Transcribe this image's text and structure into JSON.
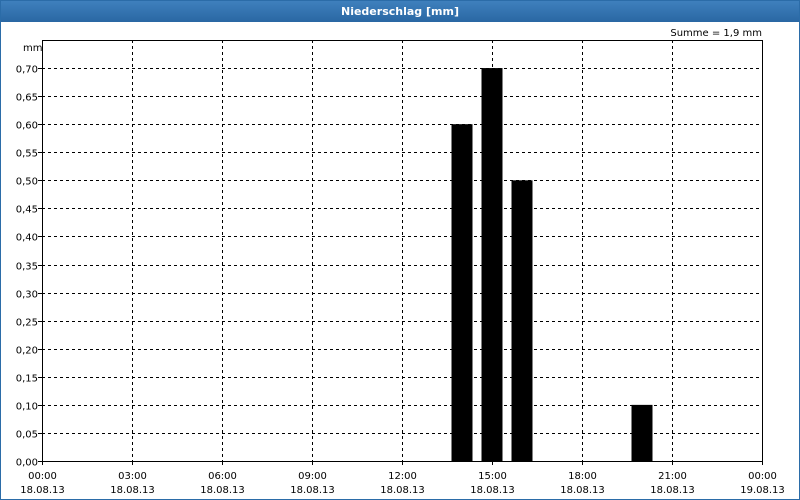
{
  "window": {
    "title": "Niederschlag [mm]"
  },
  "chart_data": {
    "type": "bar",
    "title": "Niederschlag [mm]",
    "ylabel": "mm",
    "annotation": "Summe = 1,9 mm",
    "ylim": [
      0,
      0.75
    ],
    "ytick_labels": [
      "0,00",
      "0,05",
      "0,10",
      "0,15",
      "0,20",
      "0,25",
      "0,30",
      "0,35",
      "0,40",
      "0,45",
      "0,50",
      "0,55",
      "0,60",
      "0,65",
      "0,70"
    ],
    "ytick_values": [
      0,
      0.05,
      0.1,
      0.15,
      0.2,
      0.25,
      0.3,
      0.35,
      0.4,
      0.45,
      0.5,
      0.55,
      0.6,
      0.65,
      0.7
    ],
    "xlim_hours": [
      0,
      24
    ],
    "xticks": [
      {
        "hour": 0,
        "time": "00:00",
        "date": "18.08.13"
      },
      {
        "hour": 3,
        "time": "03:00",
        "date": "18.08.13"
      },
      {
        "hour": 6,
        "time": "06:00",
        "date": "18.08.13"
      },
      {
        "hour": 9,
        "time": "09:00",
        "date": "18.08.13"
      },
      {
        "hour": 12,
        "time": "12:00",
        "date": "18.08.13"
      },
      {
        "hour": 15,
        "time": "15:00",
        "date": "18.08.13"
      },
      {
        "hour": 18,
        "time": "18:00",
        "date": "18.08.13"
      },
      {
        "hour": 21,
        "time": "21:00",
        "date": "18.08.13"
      },
      {
        "hour": 24,
        "time": "00:00",
        "date": "19.08.13"
      }
    ],
    "bars": [
      {
        "hour": 14,
        "value": 0.6
      },
      {
        "hour": 15,
        "value": 0.7
      },
      {
        "hour": 16,
        "value": 0.5
      },
      {
        "hour": 20,
        "value": 0.1
      }
    ],
    "grid": true,
    "colors": {
      "bar": "#000000",
      "grid": "#000000",
      "title_bar": "#2f6fae"
    }
  }
}
